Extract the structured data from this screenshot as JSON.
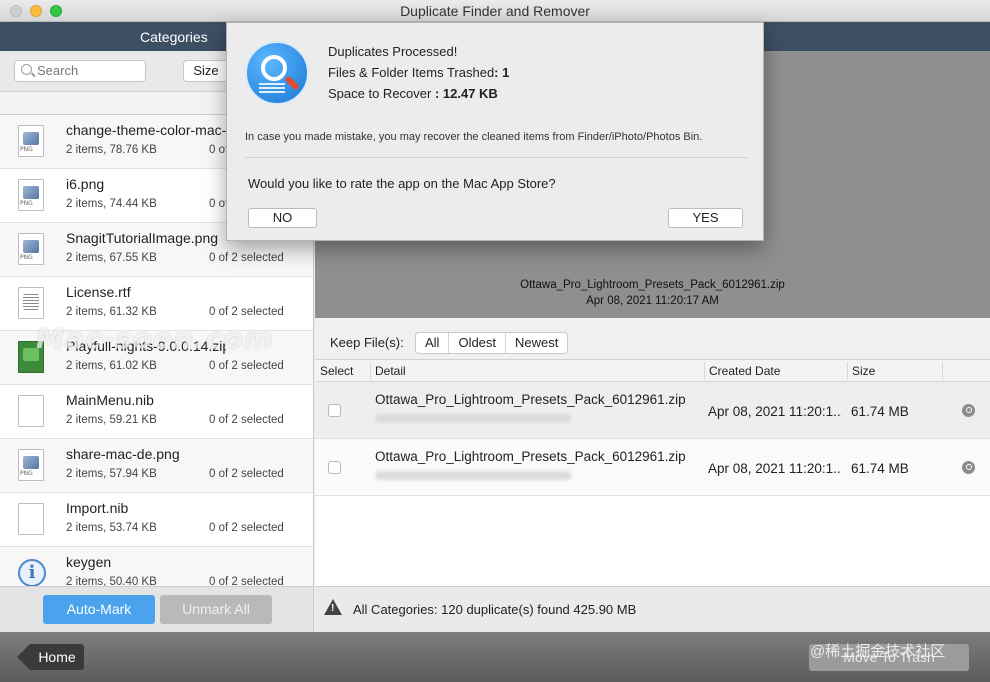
{
  "window": {
    "title": "Duplicate Finder and Remover"
  },
  "category_bar": {
    "title": "Categories"
  },
  "left_panel": {
    "search_placeholder": "Search",
    "sort_label": "Size",
    "files": [
      {
        "name": "change-theme-color-mac-",
        "meta": "2 items, 78.76 KB",
        "selected": "0 of 2 selected",
        "icon": "png-file-icon"
      },
      {
        "name": "i6.png",
        "meta": "2 items, 74.44 KB",
        "selected": "0 of 2 selected",
        "icon": "png-file-icon"
      },
      {
        "name": "SnagitTutorialImage.png",
        "meta": "2 items, 67.55 KB",
        "selected": "0 of 2 selected",
        "icon": "png-file-icon"
      },
      {
        "name": "License.rtf",
        "meta": "2 items, 61.32 KB",
        "selected": "0 of 2 selected",
        "icon": "rtf-file-icon"
      },
      {
        "name": "Playfull-nights-9.0.0.14.zip",
        "meta": "2 items, 61.02 KB",
        "selected": "0 of 2 selected",
        "icon": "zip-file-icon"
      },
      {
        "name": "MainMenu.nib",
        "meta": "2 items, 59.21 KB",
        "selected": "0 of 2 selected",
        "icon": "blank-file-icon"
      },
      {
        "name": "share-mac-de.png",
        "meta": "2 items, 57.94 KB",
        "selected": "0 of 2 selected",
        "icon": "png-file-icon"
      },
      {
        "name": "Import.nib",
        "meta": "2 items, 53.74 KB",
        "selected": "0 of 2 selected",
        "icon": "blank-file-icon"
      },
      {
        "name": "keygen",
        "meta": "2 items, 50.40 KB",
        "selected": "0 of 2 selected",
        "icon": "info-icon"
      }
    ],
    "auto_mark": "Auto-Mark",
    "unmark_all": "Unmark All"
  },
  "preview": {
    "file_name": "Ottawa_Pro_Lightroom_Presets_Pack_6012961.zip",
    "file_date": "Apr 08, 2021 11:20:17 AM"
  },
  "keep": {
    "label": "Keep File(s):",
    "options": [
      "All",
      "Oldest",
      "Newest"
    ]
  },
  "table": {
    "headers": {
      "select": "Select",
      "detail": "Detail",
      "created": "Created Date",
      "size": "Size"
    },
    "rows": [
      {
        "name": "Ottawa_Pro_Lightroom_Presets_Pack_6012961.zip",
        "created": "Apr 08, 2021 11:20:1...",
        "size": "61.74 MB"
      },
      {
        "name": "Ottawa_Pro_Lightroom_Presets_Pack_6012961.zip",
        "created": "Apr 08, 2021 11:20:1...",
        "size": "61.74 MB"
      }
    ]
  },
  "status": {
    "text": "All Categories: 120 duplicate(s) found 425.90 MB"
  },
  "footer": {
    "home": "Home",
    "move_to_trash": "Move To Trash"
  },
  "dialog": {
    "line1": "Duplicates Processed!",
    "line2_label": "Files & Folder Items Trashed",
    "line2_value": ": 1",
    "line3_label": "Space to Recover",
    "line3_value": " : 12.47 KB",
    "note": "In case you made mistake, you may recover the cleaned items from Finder/iPhoto/Photos Bin.",
    "question": "Would you like to rate the app on the Mac App Store?",
    "no": "NO",
    "yes": "YES"
  },
  "watermarks": {
    "main": "Mac-soon.com",
    "corner": "@稀土掘金技术社区"
  }
}
